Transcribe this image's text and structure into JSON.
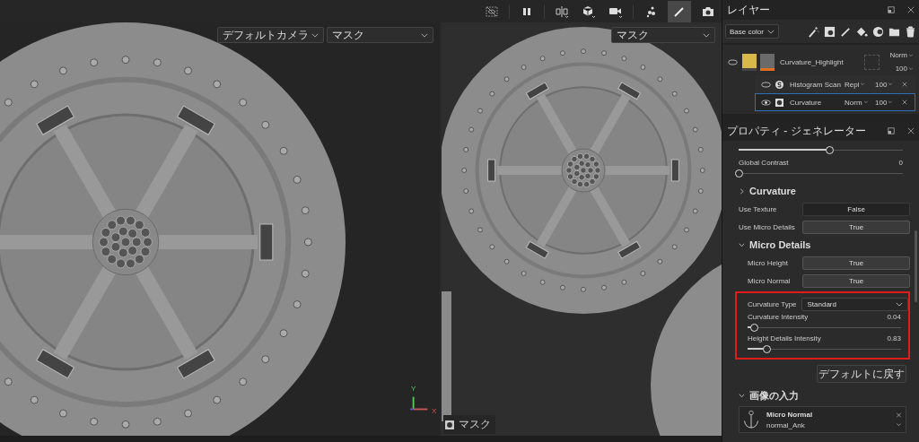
{
  "viewport_3d": {
    "camera_dropdown": "デフォルトカメラ",
    "channel_dropdown": "マスク",
    "axis": {
      "y": "Y",
      "x": "X"
    }
  },
  "viewport_2d": {
    "channel_dropdown": "マスク",
    "mask_label": "マスク"
  },
  "layers_panel": {
    "title": "レイヤー",
    "channel": "Base color",
    "layers": [
      {
        "name": "Curvature_Highlight",
        "blend": "Norm",
        "opacity": "100",
        "effects": [
          {
            "kind": "filter",
            "name": "Histogram Scan",
            "blend": "Repl",
            "opacity": "100",
            "selected": false
          },
          {
            "kind": "generator",
            "name": "Curvature",
            "blend": "Norm",
            "opacity": "100",
            "selected": true
          }
        ]
      }
    ]
  },
  "properties_panel": {
    "title": "プロパティ - ジェネレーター",
    "items": [
      {
        "kind": "slider",
        "level": 0.55
      },
      {
        "kind": "slider",
        "label": "Global Contrast",
        "value": "0",
        "level": 0
      },
      {
        "kind": "section",
        "label": "Curvature",
        "expanded": false
      },
      {
        "kind": "toggle",
        "label": "Use Texture",
        "value": "False",
        "on": false
      },
      {
        "kind": "toggle",
        "label": "Use Micro Details",
        "value": "True",
        "on": true
      },
      {
        "kind": "section",
        "label": "Micro Details",
        "expanded": true,
        "children": [
          {
            "kind": "toggle",
            "label": "Micro Height",
            "value": "True",
            "on": true
          },
          {
            "kind": "toggle",
            "label": "Micro Normal",
            "value": "True",
            "on": true
          }
        ]
      },
      {
        "kind": "group",
        "highlighted": true,
        "children": [
          {
            "kind": "dropdown",
            "label": "Curvature Type",
            "value": "Standard"
          },
          {
            "kind": "slider",
            "label": "Curvature Intensity",
            "value": "0.04",
            "level": 0.04
          },
          {
            "kind": "slider",
            "label": "Height Details Intensity",
            "value": "0.83",
            "level": 0.12
          }
        ]
      },
      {
        "kind": "button",
        "label": "デフォルトに戻す"
      },
      {
        "kind": "section",
        "label": "画像の入力",
        "expanded": true,
        "children": [
          {
            "kind": "input",
            "label": "Micro Normal",
            "value": "normal_Ank"
          }
        ]
      }
    ]
  }
}
